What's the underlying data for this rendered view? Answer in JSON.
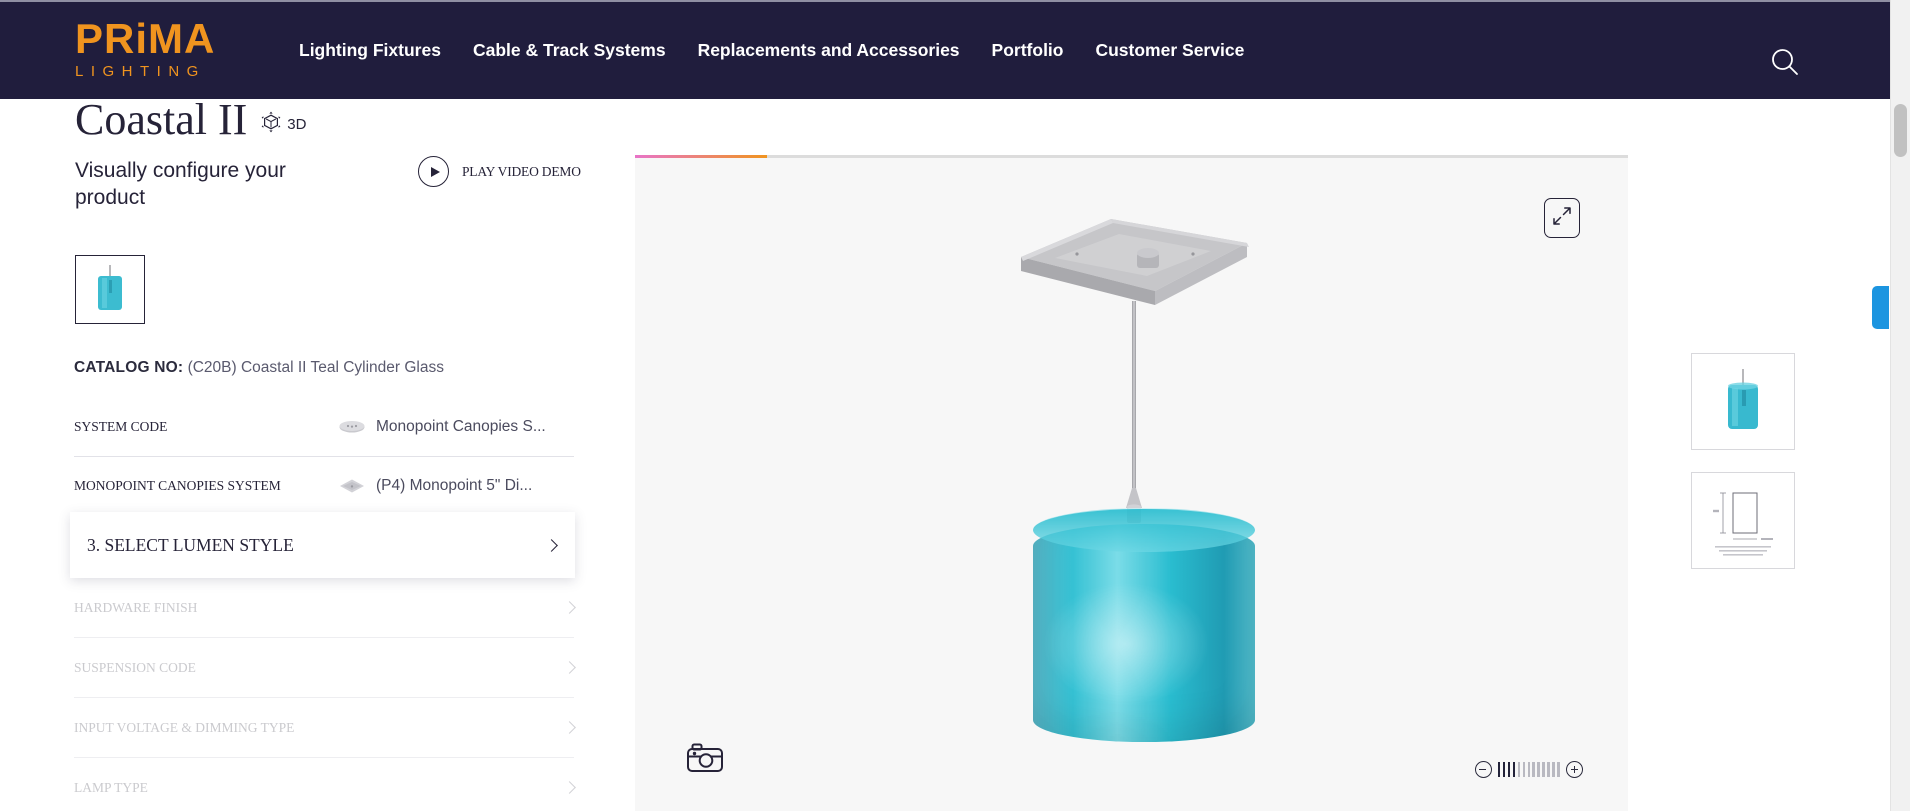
{
  "header": {
    "brand_main": "PRiMA",
    "brand_sub": "LIGHTING",
    "nav_items": [
      {
        "label": "Lighting Fixtures"
      },
      {
        "label": "Cable & Track Systems"
      },
      {
        "label": "Replacements and Accessories"
      },
      {
        "label": "Portfolio"
      },
      {
        "label": "Customer Service"
      }
    ],
    "search_icon": "search-icon",
    "background_color": "#201d3d",
    "brand_color": "#f0941f"
  },
  "configurator": {
    "product_title": "Coastal II",
    "badge_3d": "3D",
    "badge_3d_icon": "cube-3d-icon",
    "subtitle": "Visually configure your product",
    "play_video_label": "PLAY VIDEO DEMO",
    "play_icon": "play-icon",
    "thumbnail_name": "product-thumbnail",
    "catalog_label": "CATALOG NO:",
    "catalog_value": "(C20B) Coastal II Teal Cylinder Glass",
    "specs": [
      {
        "name": "SYSTEM CODE",
        "value": "Monopoint Canopies S...",
        "icon": "canopy-round-icon"
      },
      {
        "name": "MONOPOINT CANOPIES SYSTEM",
        "value": "(P4) Monopoint 5\" Di...",
        "icon": "canopy-square-icon"
      }
    ],
    "active_step": {
      "label": "3. SELECT LUMEN STYLE",
      "chevron_icon": "chevron-right-icon"
    },
    "disabled_steps": [
      {
        "label": "HARDWARE FINISH"
      },
      {
        "label": "SUSPENSION CODE"
      },
      {
        "label": "INPUT VOLTAGE & DIMMING TYPE"
      },
      {
        "label": "LAMP TYPE"
      }
    ]
  },
  "viewer": {
    "progress_percent": 13,
    "progress_gradient_from": "#e874c8",
    "progress_gradient_to": "#f0941f",
    "background_color": "#f7f7f7",
    "expand_icon": "expand-arrows-icon",
    "snapshot_icon": "camera-icon",
    "zoom": {
      "minus_icon": "zoom-out-icon",
      "plus_icon": "zoom-in-icon",
      "filled_steps": 4,
      "total_steps": 13
    },
    "model": {
      "glass_color": "#24bcd0",
      "hardware_color": "#b6b6b9"
    }
  },
  "side_thumbnails": [
    {
      "name": "product-photo-thumbnail"
    },
    {
      "name": "dimension-drawing-thumbnail"
    }
  ],
  "side_tab": {
    "name": "chat-tab",
    "color": "#1c95e0"
  }
}
